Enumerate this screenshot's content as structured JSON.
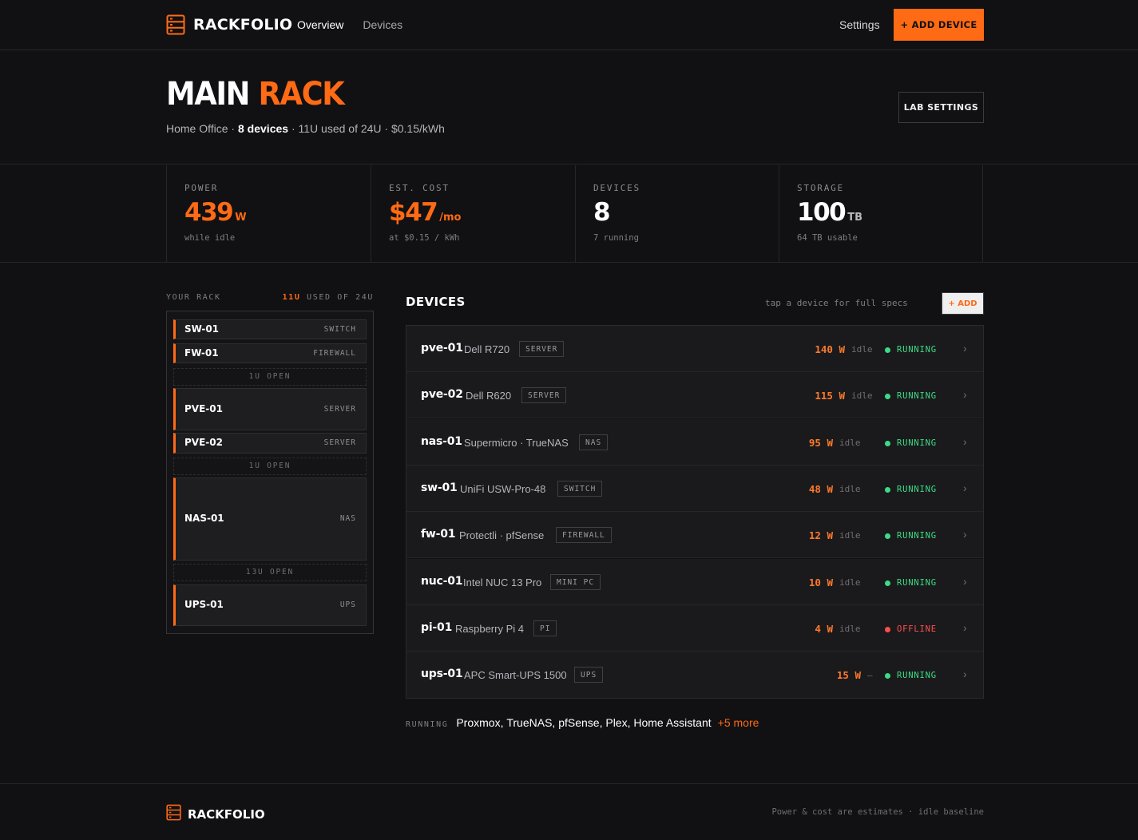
{
  "brand": "RACKFOLIO",
  "nav": {
    "items": [
      {
        "label": "Overview",
        "active": true
      },
      {
        "label": "Devices",
        "active": false
      }
    ],
    "settings": "Settings",
    "add_device": "+ ADD DEVICE"
  },
  "hero": {
    "title_a": "MAIN",
    "title_b": "RACK",
    "location": "Home Office",
    "sep1": " · ",
    "devices": "8 devices",
    "rest": " · 11U used of 24U · $0.15/kWh",
    "lab_settings": "LAB SETTINGS"
  },
  "stats": [
    {
      "label": "POWER",
      "value": "439",
      "unit": "W",
      "note": "while idle",
      "accent": true
    },
    {
      "label": "EST. COST",
      "value": "$47",
      "unit": "/mo",
      "note": "at $0.15 / kWh",
      "accent": true
    },
    {
      "label": "DEVICES",
      "value": "8",
      "unit": "",
      "note": "7 running",
      "accent": false
    },
    {
      "label": "STORAGE",
      "value": "100",
      "unit": "TB",
      "note": "64 TB usable",
      "accent": false
    }
  ],
  "rack": {
    "label": "YOUR RACK",
    "used": "11U",
    "of": "USED OF 24U",
    "slots": [
      {
        "kind": "device",
        "name": "SW-01",
        "type": "SWITCH"
      },
      {
        "kind": "device",
        "name": "FW-01",
        "type": "FIREWALL"
      },
      {
        "kind": "open",
        "label": "1U OPEN"
      },
      {
        "kind": "device",
        "name": "PVE-01",
        "type": "SERVER"
      },
      {
        "kind": "device",
        "name": "PVE-02",
        "type": "SERVER"
      },
      {
        "kind": "open",
        "label": "1U OPEN"
      },
      {
        "kind": "device",
        "name": "NAS-01",
        "type": "NAS"
      },
      {
        "kind": "open",
        "label": "13U OPEN"
      },
      {
        "kind": "device",
        "name": "UPS-01",
        "type": "UPS"
      }
    ]
  },
  "devices": {
    "title": "DEVICES",
    "hint": "tap a device for full specs",
    "add": "+ ADD",
    "rows": [
      {
        "name": "pve-01",
        "model": "Dell R720",
        "badge": "SERVER",
        "watts": "140 W",
        "idle": "idle",
        "status": "RUNNING",
        "online": true
      },
      {
        "name": "pve-02",
        "model": "Dell R620",
        "badge": "SERVER",
        "watts": "115 W",
        "idle": "idle",
        "status": "RUNNING",
        "online": true
      },
      {
        "name": "nas-01",
        "model": "Supermicro · TrueNAS",
        "badge": "NAS",
        "watts": "95 W",
        "idle": "idle",
        "status": "RUNNING",
        "online": true
      },
      {
        "name": "sw-01",
        "model": "UniFi USW-Pro-48",
        "badge": "SWITCH",
        "watts": "48 W",
        "idle": "idle",
        "status": "RUNNING",
        "online": true
      },
      {
        "name": "fw-01",
        "model": "Protectli · pfSense",
        "badge": "FIREWALL",
        "watts": "12 W",
        "idle": "idle",
        "status": "RUNNING",
        "online": true
      },
      {
        "name": "nuc-01",
        "model": "Intel NUC 13 Pro",
        "badge": "MINI PC",
        "watts": "10 W",
        "idle": "idle",
        "status": "RUNNING",
        "online": true
      },
      {
        "name": "pi-01",
        "model": "Raspberry Pi 4",
        "badge": "PI",
        "watts": "4 W",
        "idle": "idle",
        "status": "OFFLINE",
        "online": false
      },
      {
        "name": "ups-01",
        "model": "APC Smart-UPS 1500",
        "badge": "UPS",
        "watts": "15 W",
        "idle": "–",
        "status": "RUNNING",
        "online": true
      }
    ]
  },
  "running": {
    "label": "RUNNING",
    "apps": [
      "Proxmox",
      "TrueNAS",
      "pfSense",
      "Plex",
      "Home Assistant"
    ],
    "more": "+5 more"
  },
  "footer": {
    "brand": "RACKFOLIO",
    "note": "Power & cost are estimates · idle baseline"
  },
  "colors": {
    "accent": "#ff6a14",
    "running": "#3ddc84",
    "offline": "#ff4d4d"
  }
}
